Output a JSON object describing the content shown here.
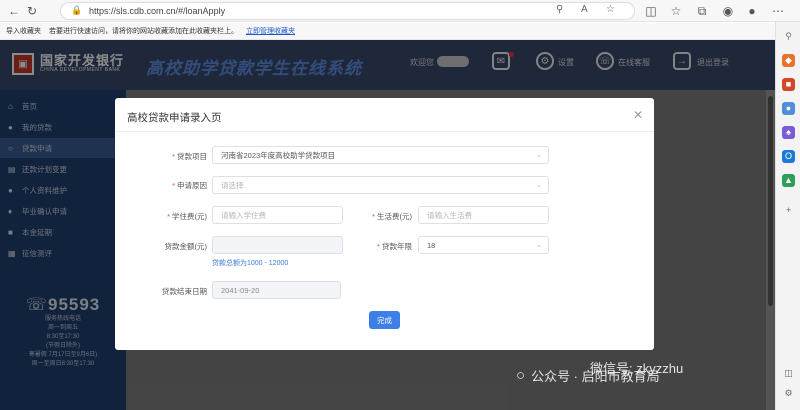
{
  "browser": {
    "url": "https://sls.cdb.com.cn/#/loanApply",
    "bookmarks": {
      "import_label": "导入收藏夹",
      "message": "若要进行快速访问，请将你的网站收藏添加在此收藏夹栏上。",
      "manage_link": "立即管理收藏夹"
    }
  },
  "header": {
    "bank_name_cn": "国家开发银行",
    "bank_name_en": "CHINA DEVELOPMENT BANK",
    "system_title": "高校助学贷款学生在线系统",
    "welcome": "欢迎您",
    "settings": "设置",
    "service": "在线客服",
    "logout": "退出登录"
  },
  "sidebar": {
    "items": [
      {
        "label": "首页",
        "icon": "home-icon"
      },
      {
        "label": "我的贷款",
        "icon": "user-icon"
      },
      {
        "label": "贷款申请",
        "icon": "apply-icon"
      },
      {
        "label": "还款计划变更",
        "icon": "plan-icon"
      },
      {
        "label": "个人资料维护",
        "icon": "profile-icon"
      },
      {
        "label": "毕业确认申请",
        "icon": "graduate-icon"
      },
      {
        "label": "本金延期",
        "icon": "extend-icon"
      },
      {
        "label": "征信测评",
        "icon": "credit-icon"
      }
    ],
    "hotline": {
      "number": "95593",
      "lines": [
        "服务热线电话",
        "周一到周五",
        "8:30至17:30",
        "(节假日除外)",
        "寒暑假 7月17日至9月6日)",
        "周一至周日8:30至17:30"
      ]
    }
  },
  "modal": {
    "title": "高校贷款申请录入页",
    "close_icon": "close-icon",
    "fields": {
      "loan_project": {
        "label": "贷款项目",
        "value": "河南省2023年度高校助学贷款项目"
      },
      "reason": {
        "label": "申请原因",
        "placeholder": "请选择"
      },
      "tuition": {
        "label": "学住费(元)",
        "placeholder": "请输入学住费"
      },
      "living": {
        "label": "生活费(元)",
        "placeholder": "请输入生活费"
      },
      "amount": {
        "label": "贷款金额(元)",
        "value": "",
        "hint": "贷款总额为1000 - 12000"
      },
      "years": {
        "label": "贷款年限",
        "value": "18"
      },
      "end_date": {
        "label": "贷款结束日期",
        "value": "2041-09-20"
      }
    },
    "done_label": "完成"
  },
  "watermark": {
    "line1": "微信号: zkyzzhu",
    "line2": "公众号 · 启阳市教育局"
  },
  "colors": {
    "header": "#3a4a6b",
    "sidebar": "#1e3e6e",
    "primary": "#3d7ee8",
    "required": "#e64b4b"
  }
}
